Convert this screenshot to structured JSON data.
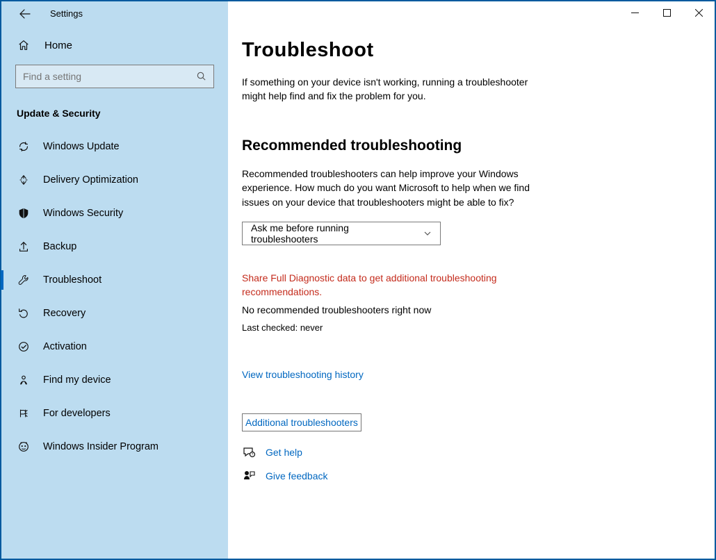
{
  "app": {
    "title": "Settings"
  },
  "sidebar": {
    "home": "Home",
    "search_placeholder": "Find a setting",
    "section": "Update & Security",
    "items": [
      {
        "label": "Windows Update"
      },
      {
        "label": "Delivery Optimization"
      },
      {
        "label": "Windows Security"
      },
      {
        "label": "Backup"
      },
      {
        "label": "Troubleshoot"
      },
      {
        "label": "Recovery"
      },
      {
        "label": "Activation"
      },
      {
        "label": "Find my device"
      },
      {
        "label": "For developers"
      },
      {
        "label": "Windows Insider Program"
      }
    ]
  },
  "main": {
    "title": "Troubleshoot",
    "intro": "If something on your device isn't working, running a troubleshooter might help find and fix the problem for you.",
    "rec_heading": "Recommended troubleshooting",
    "rec_desc": "Recommended troubleshooters can help improve your Windows experience. How much do you want Microsoft to help when we find issues on your device that troubleshooters might be able to fix?",
    "dropdown_value": "Ask me before running troubleshooters",
    "warn": "Share Full Diagnostic data to get additional troubleshooting recommendations.",
    "no_rec": "No recommended troubleshooters right now",
    "last_checked": "Last checked: never",
    "history_link": "View troubleshooting history",
    "additional_link": "Additional troubleshooters",
    "get_help": "Get help",
    "give_feedback": "Give feedback"
  }
}
